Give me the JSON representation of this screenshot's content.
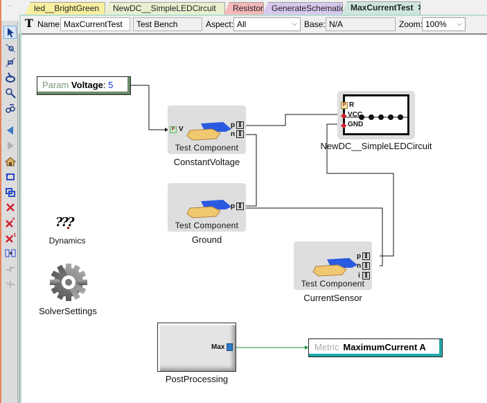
{
  "tabs": [
    {
      "label": "led__BrightGreen",
      "color": "#f8f0a0"
    },
    {
      "label": "NewDC__SimpleLEDCircuit",
      "color": "#e8f0d0"
    },
    {
      "label": "Resistor",
      "color": "#f4b8b8"
    },
    {
      "label": "GenerateSchematic",
      "color": "#d8c8f0"
    },
    {
      "label": "MaxCurrentTest",
      "color": "#cfe6dc",
      "active": true,
      "close": "✕"
    }
  ],
  "toolbar": {
    "name_label": "Name:",
    "name_value": "MaxCurrentTest",
    "kind_value": "Test Bench",
    "aspect_label": "Aspect:",
    "aspect_value": "All",
    "base_label": "Base:",
    "base_value": "N/A",
    "zoom_label": "Zoom:",
    "zoom_value": "100%"
  },
  "palette": {
    "tools": [
      "select-arrow",
      "zoom-connect",
      "disconnect",
      "set-mode",
      "zoom",
      "visualize",
      "back",
      "forward",
      "home",
      "cycle-aspects",
      "cycle-all-aspects",
      "delete",
      "delete-all",
      "delete-references",
      "show-basetype",
      "connect-disabled",
      "disconnect-disabled"
    ]
  },
  "canvas": {
    "param": {
      "kw": "Param",
      "name": "Voltage",
      "sep": ": ",
      "value": "5"
    },
    "components": [
      {
        "id": "constant-voltage",
        "subtitle": "Test Component",
        "name": "ConstantVoltage",
        "ports_in": [
          "V"
        ],
        "ports_out": [
          "p",
          "n"
        ]
      },
      {
        "id": "ground",
        "subtitle": "Test Component",
        "name": "Ground",
        "ports_out": [
          "p"
        ]
      },
      {
        "id": "current-sensor",
        "subtitle": "Test Component",
        "name": "CurrentSensor",
        "ports_out": [
          "p",
          "n",
          "i"
        ]
      }
    ],
    "led_circuit": {
      "name": "NewDC__SimpleLEDCircuit",
      "ports": [
        "R",
        "VCC",
        "GND"
      ]
    },
    "dynamics": {
      "icon": "???",
      "name": "Dynamics"
    },
    "solver": {
      "name": "SolverSettings"
    },
    "postprocessing": {
      "name": "PostProcessing",
      "port": "Max"
    },
    "metric": {
      "kw": "Metric",
      "name": "MaximumCurrent A"
    },
    "port_glyph": "I",
    "param_badge": "P"
  }
}
